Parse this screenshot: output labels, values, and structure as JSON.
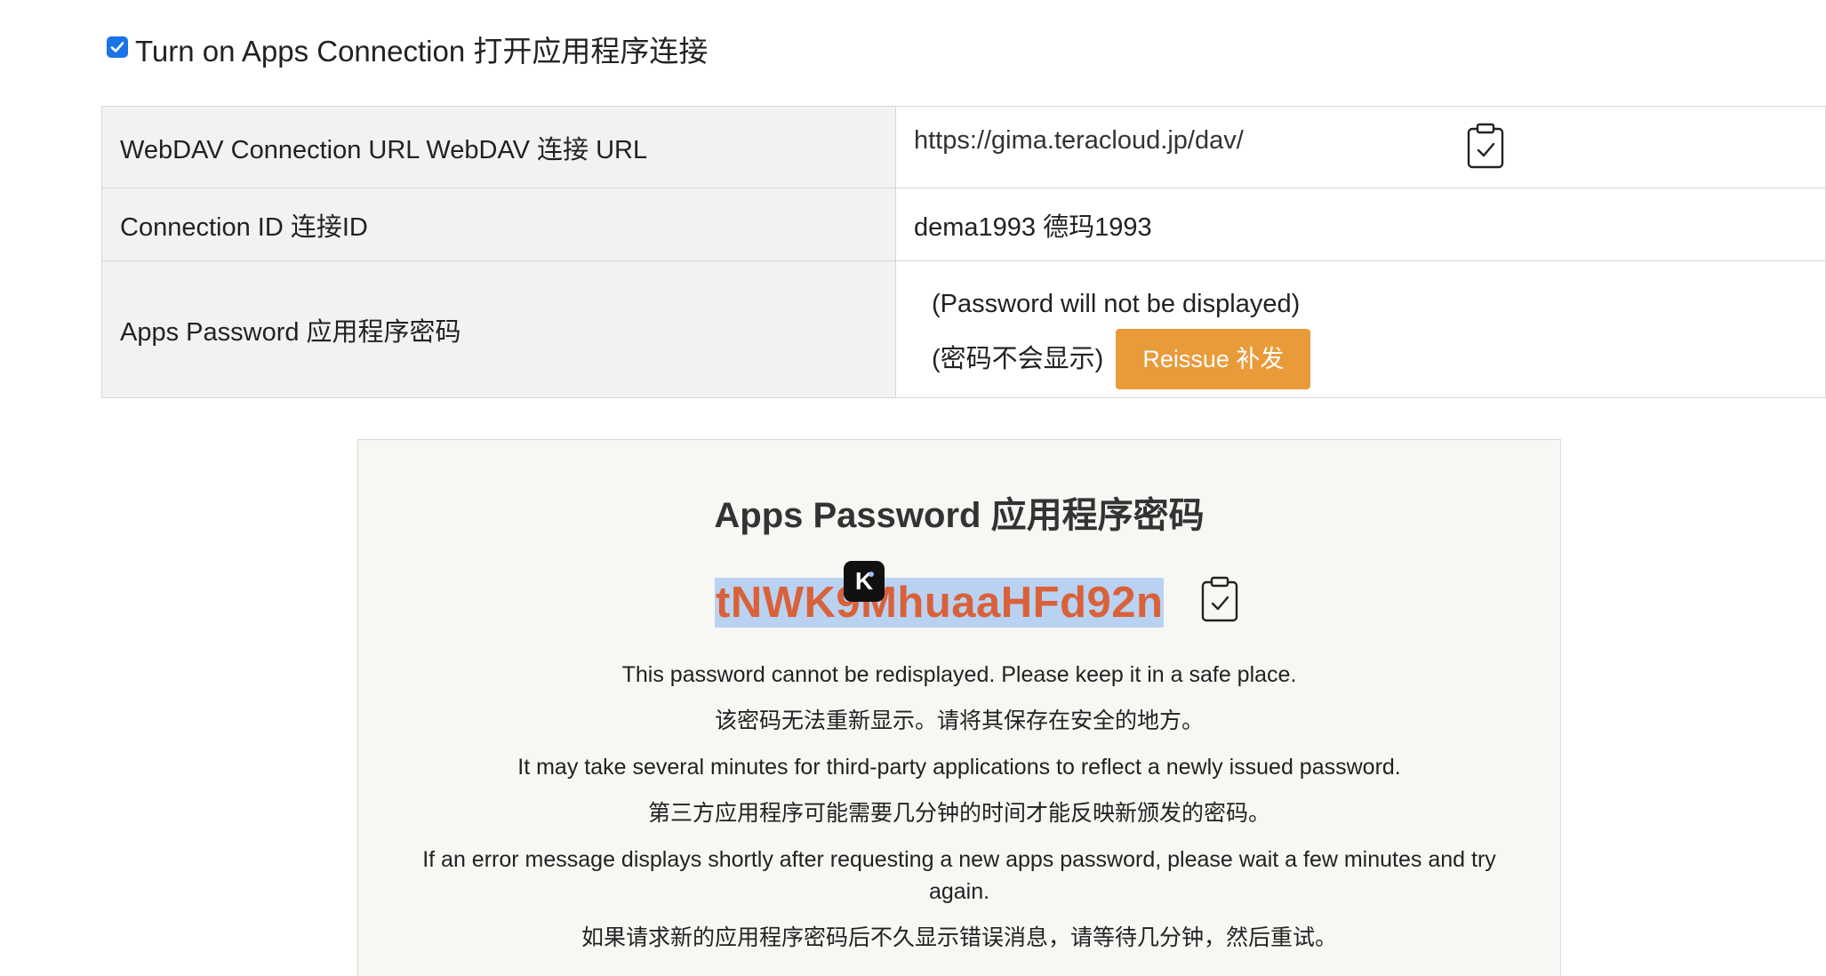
{
  "apps_connection": {
    "checked": true,
    "label": "Turn on Apps Connection 打开应用程序连接"
  },
  "settings": {
    "webdav_url_label": "WebDAV Connection URL WebDAV 连接 URL",
    "webdav_url_value": "https://gima.teracloud.jp/dav/",
    "connection_id_label": "Connection ID 连接ID",
    "connection_id_value": "dema1993 德玛1993",
    "apps_password_label": "Apps Password 应用程序密码",
    "password_hint_line1": "(Password will not be displayed)",
    "password_hint_line2": "(密码不会显示)",
    "reissue_button": "Reissue 补发"
  },
  "result": {
    "title": "Apps Password 应用程序密码",
    "password": "tNWK9MhuaaHFd92n",
    "badge": "K",
    "notes": [
      "This password cannot be redisplayed. Please keep it in a safe place.",
      "该密码无法重新显示。请将其保存在安全的地方。",
      "It may take several minutes for third-party applications to reflect a newly issued password.",
      "第三方应用程序可能需要几分钟的时间才能反映新颁发的密码。",
      "If an error message displays shortly after requesting a new apps password, please wait a few minutes and try again.",
      "如果请求新的应用程序密码后不久显示错误消息，请等待几分钟，然后重试。"
    ]
  },
  "icons": {
    "clipboard": "clipboard-check-icon",
    "checkbox": "checkbox-checked-icon",
    "badge": "k-badge-icon"
  },
  "colors": {
    "checkbox": "#1a73e8",
    "reissue_button": "#e99b3a",
    "password_text": "#d9613a",
    "password_highlight": "#b9d2f2",
    "panel_background": "#f7f7f4",
    "label_background": "#f2f2f2"
  }
}
